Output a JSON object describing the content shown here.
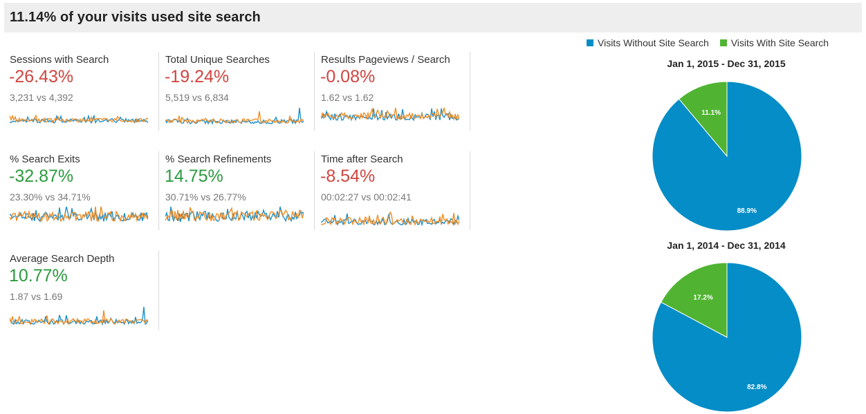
{
  "header": {
    "title": "11.14% of your visits used site search"
  },
  "metrics": [
    {
      "label": "Sessions with Search",
      "change": "-26.43%",
      "compare": "3,231 vs 4,392",
      "trend": "negative"
    },
    {
      "label": "Total Unique Searches",
      "change": "-19.24%",
      "compare": "5,519 vs 6,834",
      "trend": "negative"
    },
    {
      "label": "Results Pageviews / Search",
      "change": "-0.08%",
      "compare": "1.62 vs 1.62",
      "trend": "negative"
    },
    {
      "label": "% Search Exits",
      "change": "-32.87%",
      "compare": "23.30% vs 34.71%",
      "trend": "positive"
    },
    {
      "label": "% Search Refinements",
      "change": "14.75%",
      "compare": "30.71% vs 26.77%",
      "trend": "positive"
    },
    {
      "label": "Time after Search",
      "change": "-8.54%",
      "compare": "00:02:27 vs 00:02:41",
      "trend": "negative"
    },
    {
      "label": "Average Search Depth",
      "change": "10.77%",
      "compare": "1.87 vs 1.69",
      "trend": "positive"
    }
  ],
  "legend": {
    "items": [
      {
        "label": "Visits Without Site Search",
        "color": "#058dc7"
      },
      {
        "label": "Visits With Site Search",
        "color": "#50b432"
      }
    ]
  },
  "colors": {
    "current": "#f08c24",
    "previous": "#1f8fc6",
    "negative": "#d0453f",
    "positive": "#2b9a3f"
  },
  "chart_data": [
    {
      "type": "pie",
      "title": "Jan 1, 2015 - Dec 31, 2015",
      "slices": [
        {
          "name": "Visits Without Site Search",
          "value": 88.9,
          "label": "88.9%",
          "color": "#058dc7"
        },
        {
          "name": "Visits With Site Search",
          "value": 11.1,
          "label": "11.1%",
          "color": "#50b432"
        }
      ]
    },
    {
      "type": "pie",
      "title": "Jan 1, 2014 - Dec 31, 2014",
      "slices": [
        {
          "name": "Visits Without Site Search",
          "value": 82.8,
          "label": "82.8%",
          "color": "#058dc7"
        },
        {
          "name": "Visits With Site Search",
          "value": 17.2,
          "label": "17.2%",
          "color": "#50b432"
        }
      ]
    }
  ]
}
